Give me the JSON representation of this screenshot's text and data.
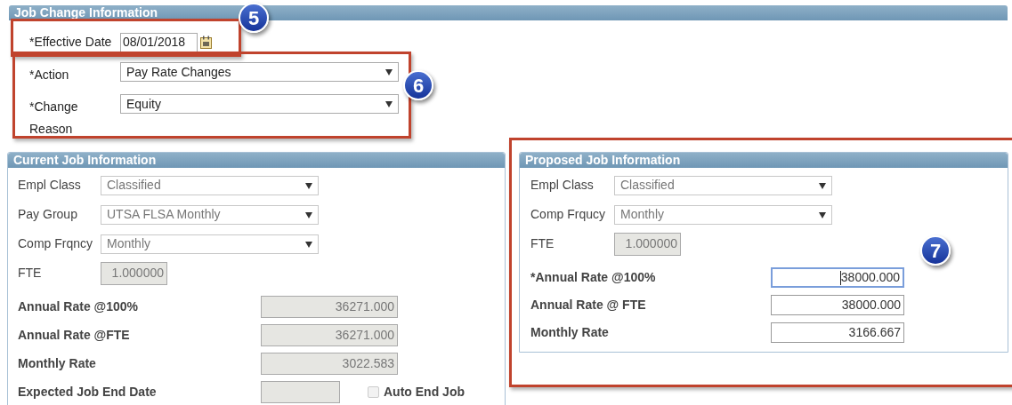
{
  "section": {
    "title": "Job Change Information"
  },
  "header_fields": [
    {
      "kind": "date",
      "label": "*Effective Date",
      "value": "08/01/2018"
    },
    {
      "kind": "select",
      "label": "*Action",
      "value": "Pay Rate Changes",
      "disabled": false
    },
    {
      "kind": "select",
      "label": "*Change Reason",
      "value": "Equity",
      "disabled": false
    }
  ],
  "current_job": {
    "title": "Current Job Information",
    "fields": [
      {
        "kind": "select",
        "label": "Empl Class",
        "value": "Classified",
        "disabled": true
      },
      {
        "kind": "select",
        "label": "Pay Group",
        "value": "UTSA FLSA Monthly",
        "disabled": true
      },
      {
        "kind": "select",
        "label": "Comp Frqncy",
        "value": "Monthly",
        "disabled": true
      },
      {
        "kind": "short_readonly",
        "label": "FTE",
        "value": "1.000000"
      },
      {
        "kind": "rate_readonly",
        "label": "Annual Rate @100%",
        "value": "36271.000"
      },
      {
        "kind": "rate_readonly",
        "label": "Annual Rate @FTE",
        "value": "36271.000"
      },
      {
        "kind": "rate_readonly",
        "label": "Monthly Rate",
        "value": "3022.583"
      },
      {
        "kind": "end_date",
        "label": "Expected Job End Date",
        "checkbox": {
          "label": "Auto End Job",
          "checked": false,
          "disabled": true
        }
      }
    ]
  },
  "proposed_job": {
    "title": "Proposed Job Information",
    "fields": [
      {
        "kind": "select",
        "label": "Empl Class",
        "value": "Classified",
        "disabled": true
      },
      {
        "kind": "select",
        "label": "Comp Frqucy",
        "value": "Monthly",
        "disabled": true
      },
      {
        "kind": "short_readonly",
        "label": "FTE",
        "value": "1.000000"
      },
      {
        "kind": "rate_input",
        "label": "*Annual Rate @100%",
        "value": "38000.000",
        "focused": true
      },
      {
        "kind": "rate_input",
        "label": "Annual Rate @ FTE",
        "value": "38000.000",
        "focused": false
      },
      {
        "kind": "rate_input",
        "label": "Monthly Rate",
        "value": "3166.667",
        "focused": false
      }
    ]
  },
  "callouts": [
    {
      "number": "5"
    },
    {
      "number": "6"
    },
    {
      "number": "7"
    }
  ]
}
